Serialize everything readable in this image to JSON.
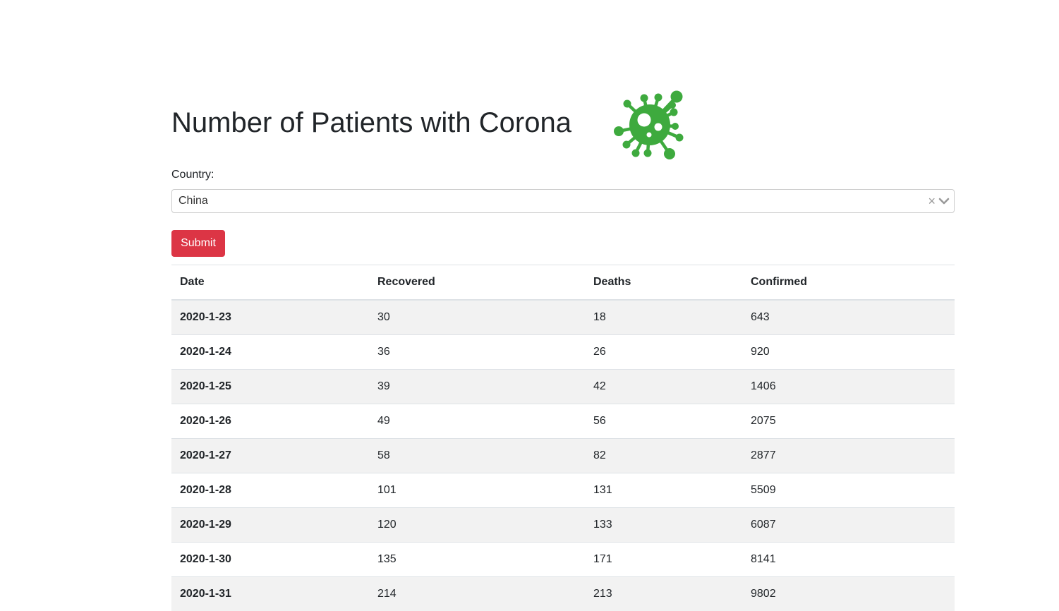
{
  "page": {
    "title": "Number of Patients with Corona",
    "logo_icon": "virus-icon",
    "logo_color": "#3eaa3e"
  },
  "form": {
    "country_label": "Country:",
    "country_value": "China",
    "clear_icon": "×",
    "submit_label": "Submit",
    "submit_color": "#dc3545"
  },
  "table": {
    "headers": [
      "Date",
      "Recovered",
      "Deaths",
      "Confirmed"
    ],
    "rows": [
      [
        "2020-1-23",
        "30",
        "18",
        "643"
      ],
      [
        "2020-1-24",
        "36",
        "26",
        "920"
      ],
      [
        "2020-1-25",
        "39",
        "42",
        "1406"
      ],
      [
        "2020-1-26",
        "49",
        "56",
        "2075"
      ],
      [
        "2020-1-27",
        "58",
        "82",
        "2877"
      ],
      [
        "2020-1-28",
        "101",
        "131",
        "5509"
      ],
      [
        "2020-1-29",
        "120",
        "133",
        "6087"
      ],
      [
        "2020-1-30",
        "135",
        "171",
        "8141"
      ],
      [
        "2020-1-31",
        "214",
        "213",
        "9802"
      ]
    ]
  }
}
